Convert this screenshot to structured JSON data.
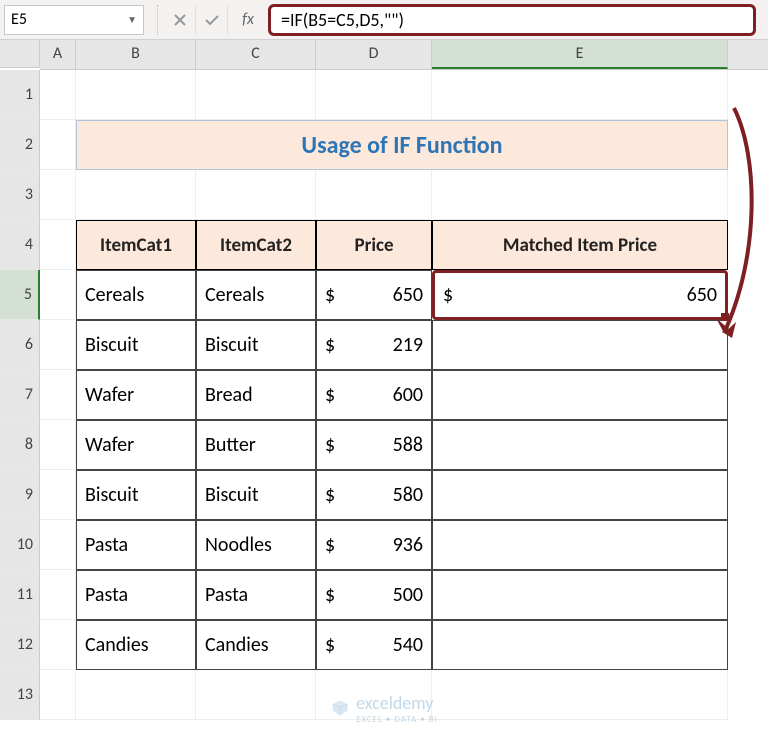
{
  "name_box": "E5",
  "formula": "=IF(B5=C5,D5,\"\")",
  "columns": [
    "A",
    "B",
    "C",
    "D",
    "E"
  ],
  "title": "Usage of IF Function",
  "headers": {
    "b": "ItemCat1",
    "c": "ItemCat2",
    "d": "Price",
    "e": "Matched Item Price"
  },
  "rows": [
    {
      "b": "Cereals",
      "c": "Cereals",
      "d": "650",
      "e": "650"
    },
    {
      "b": "Biscuit",
      "c": "Biscuit",
      "d": "219",
      "e": ""
    },
    {
      "b": "Wafer",
      "c": "Bread",
      "d": "600",
      "e": ""
    },
    {
      "b": "Wafer",
      "c": "Butter",
      "d": "588",
      "e": ""
    },
    {
      "b": "Biscuit",
      "c": "Biscuit",
      "d": "580",
      "e": ""
    },
    {
      "b": "Pasta",
      "c": "Noodles",
      "d": "936",
      "e": ""
    },
    {
      "b": "Pasta",
      "c": "Pasta",
      "d": "500",
      "e": ""
    },
    {
      "b": "Candies",
      "c": "Candies",
      "d": "540",
      "e": ""
    }
  ],
  "currency": "$",
  "watermark": {
    "brand": "exceldemy",
    "sub": "EXCEL • DATA • BI"
  }
}
